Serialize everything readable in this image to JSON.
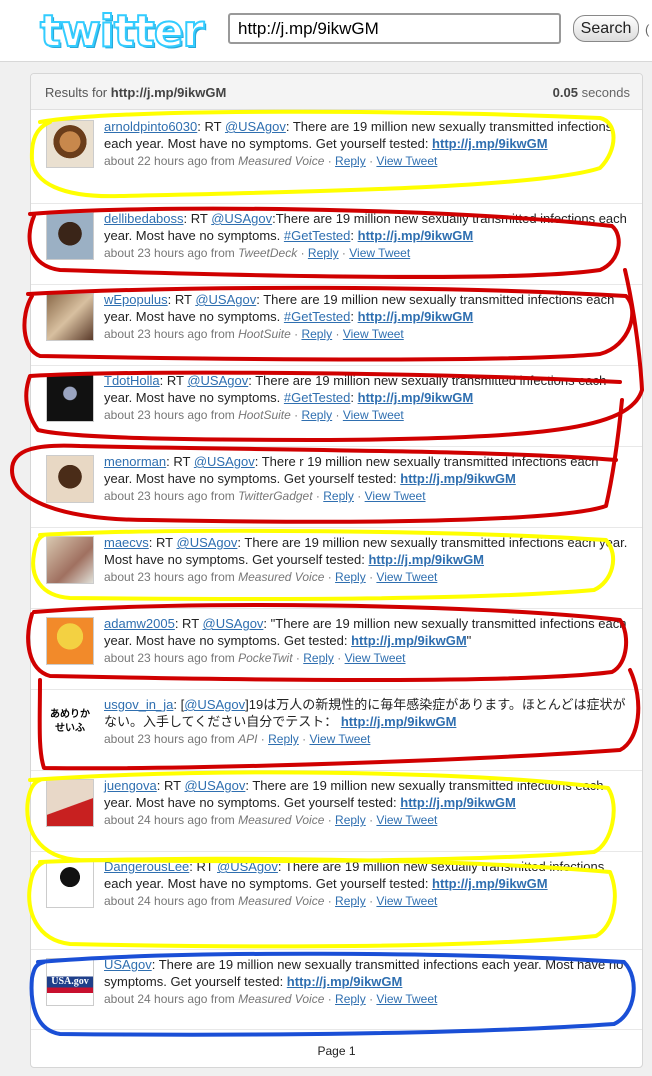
{
  "header": {
    "logo": "twitter",
    "query": "http://j.mp/9ikwGM",
    "search_label": "Search",
    "edge_text": "(",
    "results_prefix": "Results for ",
    "results_query": "http://j.mp/9ikwGM",
    "time_value": "0.05",
    "time_unit": " seconds"
  },
  "tweets": [
    {
      "user": "arnoldpinto6030",
      "pre": ": RT ",
      "mention": "@USAgov",
      "text": ": There are 19 million new sexually transmitted infections each year. Most have no symptoms. Get yourself tested: ",
      "tag": "",
      "tag_sep": "",
      "url": "http://j.mp/9ikwGM",
      "post": "",
      "time": "about 22 hours ago",
      "from": " from ",
      "source": "Measured Voice",
      "reply": "Reply",
      "view": "View Tweet"
    },
    {
      "user": "dellibedaboss",
      "pre": ": RT ",
      "mention": "@USAgov",
      "text": ":There are 19 million new sexually transmitted infections each year. Most have no symptoms. ",
      "tag": "#GetTested",
      "tag_sep": ": ",
      "url": "http://j.mp/9ikwGM",
      "post": "",
      "time": "about 23 hours ago",
      "from": " from ",
      "source": "TweetDeck",
      "reply": "Reply",
      "view": "View Tweet"
    },
    {
      "user": "wEpopulus",
      "pre": ": RT ",
      "mention": "@USAgov",
      "text": ": There are 19 million new sexually transmitted infections each year. Most have no symptoms. ",
      "tag": "#GetTested",
      "tag_sep": ": ",
      "url": "http://j.mp/9ikwGM",
      "post": "",
      "time": "about 23 hours ago",
      "from": " from ",
      "source": "HootSuite",
      "reply": "Reply",
      "view": "View Tweet"
    },
    {
      "user": "TdotHolla",
      "pre": ": RT ",
      "mention": "@USAgov",
      "text": ": There are 19 million new sexually transmitted infections each year. Most have no symptoms. ",
      "tag": "#GetTested",
      "tag_sep": ": ",
      "url": "http://j.mp/9ikwGM",
      "post": "",
      "time": "about 23 hours ago",
      "from": " from ",
      "source": "HootSuite",
      "reply": "Reply",
      "view": "View Tweet"
    },
    {
      "user": "menorman",
      "pre": ": RT ",
      "mention": "@USAgov",
      "text": ": There r 19 million new sexually transmitted infections each year. Most have no symptoms. Get yourself tested: ",
      "tag": "",
      "tag_sep": "",
      "url": "http://j.mp/9ikwGM",
      "post": "",
      "time": "about 23 hours ago",
      "from": " from ",
      "source": "TwitterGadget",
      "reply": "Reply",
      "view": "View Tweet"
    },
    {
      "user": "maecvs",
      "pre": ": RT ",
      "mention": "@USAgov",
      "text": ": There are 19 million new sexually transmitted infections each year. Most have no symptoms. Get yourself tested: ",
      "tag": "",
      "tag_sep": "",
      "url": "http://j.mp/9ikwGM",
      "post": "",
      "time": "about 23 hours ago",
      "from": " from ",
      "source": "Measured Voice",
      "reply": "Reply",
      "view": "View Tweet"
    },
    {
      "user": "adamw2005",
      "pre": ": RT ",
      "mention": "@USAgov",
      "text": ": \"There are 19 million new sexually transmitted infections each year. Most have no symptoms. Get tested: ",
      "tag": "",
      "tag_sep": "",
      "url": "http://j.mp/9ikwGM",
      "post": "\"",
      "time": "about 23 hours ago",
      "from": " from ",
      "source": "PockeTwit",
      "reply": "Reply",
      "view": "View Tweet"
    },
    {
      "user": "usgov_in_ja",
      "pre": ": [",
      "mention": "@USAgov",
      "text": "]19は万人の新規性的に毎年感染症があります。ほとんどは症状がない。入手してください自分でテスト： ",
      "tag": "",
      "tag_sep": "",
      "url": "http://j.mp/9ikwGM",
      "post": "",
      "time": "about 23 hours ago",
      "from": " from ",
      "source": "API",
      "reply": "Reply",
      "view": "View Tweet",
      "avatar_text": "あめりか せいふ"
    },
    {
      "user": "juengova",
      "pre": ": RT ",
      "mention": "@USAgov",
      "text": ": There are 19 million new sexually transmitted infections each year. Most have no symptoms. Get yourself tested: ",
      "tag": "",
      "tag_sep": "",
      "url": "http://j.mp/9ikwGM",
      "post": "",
      "time": "about 24 hours ago",
      "from": " from ",
      "source": "Measured Voice",
      "reply": "Reply",
      "view": "View Tweet"
    },
    {
      "user": "DangerousLee",
      "pre": ": RT ",
      "mention": "@USAgov",
      "text": ": There are 19 million new sexually transmitted infections each year. Most have no symptoms. Get yourself tested: ",
      "tag": "",
      "tag_sep": "",
      "url": "http://j.mp/9ikwGM",
      "post": "",
      "time": "about 24 hours ago",
      "from": " from ",
      "source": "Measured Voice",
      "reply": "Reply",
      "view": "View Tweet"
    },
    {
      "user": "USAgov",
      "pre": ": There are 19 million new sexually transmitted infections each year. Most have no symptoms. Get yourself tested: ",
      "mention": "",
      "text": "",
      "tag": "",
      "tag_sep": "",
      "url": "http://j.mp/9ikwGM",
      "post": "",
      "time": "about 24 hours ago",
      "from": " from ",
      "source": "Measured Voice",
      "reply": "Reply",
      "view": "View Tweet",
      "avatar_text": "USA.gov"
    }
  ],
  "pagination": {
    "label": "Page 1"
  },
  "colors": {
    "yellow_marker": "#ffff00",
    "red_marker": "#d00000",
    "blue_marker": "#1a4fd6",
    "link": "#2f6fb0",
    "logo": "#33ccff"
  }
}
